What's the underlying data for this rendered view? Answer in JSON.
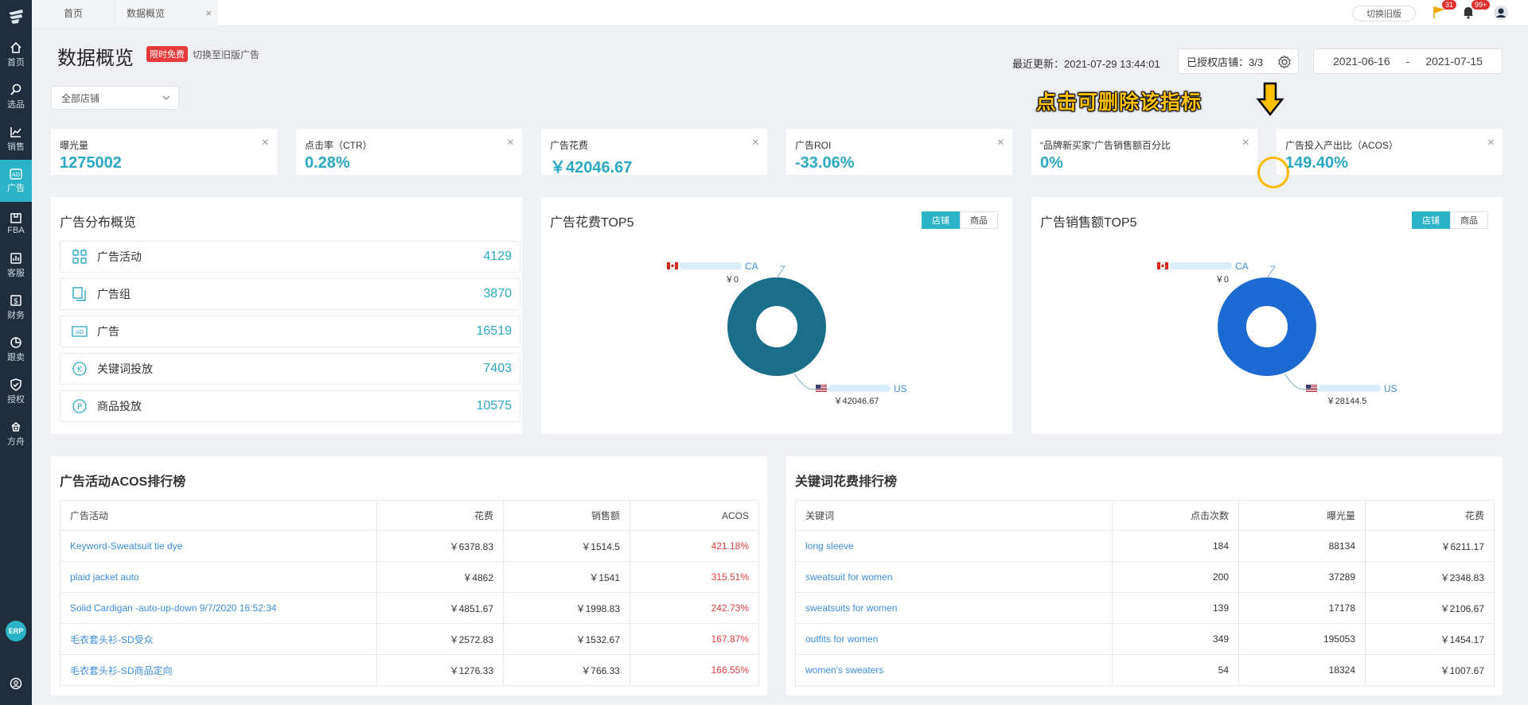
{
  "sidebar": {
    "items": [
      {
        "label": "首页",
        "icon": "home-icon"
      },
      {
        "label": "选品",
        "icon": "search-icon"
      },
      {
        "label": "销售",
        "icon": "chart-line-icon"
      },
      {
        "label": "广告",
        "icon": "ad-icon",
        "active": true
      },
      {
        "label": "FBA",
        "icon": "fba-icon"
      },
      {
        "label": "客服",
        "icon": "service-icon"
      },
      {
        "label": "财务",
        "icon": "finance-icon"
      },
      {
        "label": "跟卖",
        "icon": "pie-icon"
      },
      {
        "label": "授权",
        "icon": "shield-icon"
      },
      {
        "label": "方舟",
        "icon": "ark-icon"
      }
    ],
    "erp_label": "ERP"
  },
  "topbar": {
    "tabs": [
      "首页",
      "数据概览"
    ],
    "tab_close": "×",
    "switch_old": "切换旧版",
    "flag_badge": "31",
    "bell_badge": "99+"
  },
  "header": {
    "title": "数据概览",
    "free_tag": "限时免费",
    "switch_link": "切换至旧版广告",
    "last_update_label": "最近更新：2021-07-29 13:44:01",
    "authorized": "已授权店铺：3/3",
    "date_from": "2021-06-16",
    "date_sep": "-",
    "date_to": "2021-07-15",
    "store_select": "全部店铺",
    "hint": "点击可删除该指标"
  },
  "metrics": [
    {
      "label": "曝光量",
      "value": "1275002"
    },
    {
      "label": "点击率（CTR）",
      "value": "0.28%"
    },
    {
      "label": "广告花费",
      "value": "￥42046.67"
    },
    {
      "label": "广告ROI",
      "value": "-33.06%"
    },
    {
      "label": "“品牌新买家”广告销售额百分比",
      "value": "0%"
    },
    {
      "label": "广告投入产出比（ACOS）",
      "value": "149.40%"
    }
  ],
  "metric_close": "×",
  "distribution": {
    "title": "广告分布概览",
    "rows": [
      {
        "label": "广告活动",
        "value": "4129",
        "icon": "grid-icon"
      },
      {
        "label": "广告组",
        "value": "3870",
        "icon": "copy-icon"
      },
      {
        "label": "广告",
        "value": "16519",
        "icon": "ad-box-icon"
      },
      {
        "label": "关键词投放",
        "value": "7403",
        "icon": "k-circle-icon"
      },
      {
        "label": "商品投放",
        "value": "10575",
        "icon": "p-circle-icon"
      }
    ]
  },
  "toggle": {
    "store": "店铺",
    "product": "商品"
  },
  "chart_data": [
    {
      "type": "pie",
      "title": "广告花费TOP5",
      "categories": [
        "CA",
        "US"
      ],
      "values": [
        0,
        42046.67
      ],
      "value_labels": [
        "￥0",
        "￥42046.67"
      ],
      "colors": [
        "#1a6e8a",
        "#1a6e8a"
      ]
    },
    {
      "type": "pie",
      "title": "广告销售额TOP5",
      "categories": [
        "CA",
        "US"
      ],
      "values": [
        0,
        28144.5
      ],
      "value_labels": [
        "￥0",
        "￥28144.5"
      ],
      "colors": [
        "#1d6bd2",
        "#1d6bd2"
      ]
    }
  ],
  "acos_table": {
    "title": "广告活动ACOS排行榜",
    "columns": [
      "广告活动",
      "花费",
      "销售额",
      "ACOS"
    ],
    "rows": [
      [
        "Keyword-Sweatsuit tie dye",
        "￥6378.83",
        "￥1514.5",
        "421.18%"
      ],
      [
        "plaid jacket auto",
        "￥4862",
        "￥1541",
        "315.51%"
      ],
      [
        "Solid Cardigan -auto-up-down 9/7/2020 16:52:34",
        "￥4851.67",
        "￥1998.83",
        "242.73%"
      ],
      [
        "毛衣套头衫-SD受众",
        "￥2572.83",
        "￥1532.67",
        "167.87%"
      ],
      [
        "毛衣套头衫-SD商品定向",
        "￥1276.33",
        "￥766.33",
        "166.55%"
      ]
    ]
  },
  "keyword_table": {
    "title": "关键词花费排行榜",
    "columns": [
      "关键词",
      "点击次数",
      "曝光量",
      "花费"
    ],
    "rows": [
      [
        "long sleeve",
        "184",
        "88134",
        "￥6211.17"
      ],
      [
        "sweatsuit for women",
        "200",
        "37289",
        "￥2348.83"
      ],
      [
        "sweatsuits for women",
        "139",
        "17178",
        "￥2106.67"
      ],
      [
        "outfits for women",
        "349",
        "195053",
        "￥1454.17"
      ],
      [
        "women's sweaters",
        "54",
        "18324",
        "￥1007.67"
      ]
    ]
  }
}
